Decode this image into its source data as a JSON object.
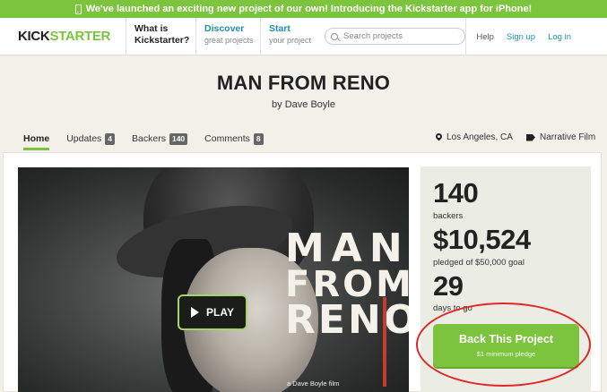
{
  "announcement": {
    "icon": "phone-icon",
    "text": "We've launched an exciting new project of our own! Introducing the Kickstarter app for iPhone!"
  },
  "header": {
    "logo": {
      "part1": "KICK",
      "part2": "STARTER"
    },
    "nav": [
      {
        "title_line1": "What is",
        "title_line2": "Kickstarter?"
      },
      {
        "title": "Discover",
        "subtitle": "great projects"
      },
      {
        "title": "Start",
        "subtitle": "your project"
      }
    ],
    "search": {
      "placeholder": "Search projects",
      "icon": "search-icon"
    },
    "links": {
      "help": "Help",
      "signup": "Sign up",
      "login": "Log in"
    }
  },
  "project": {
    "title": "MAN FROM RENO",
    "byline": "by Dave Boyle"
  },
  "tabs": [
    {
      "label": "Home",
      "active": true
    },
    {
      "label": "Updates",
      "count": "4"
    },
    {
      "label": "Backers",
      "count": "140"
    },
    {
      "label": "Comments",
      "count": "8"
    }
  ],
  "meta": {
    "location": "Los Angeles, CA",
    "location_icon": "map-pin-icon",
    "category": "Narrative Film",
    "category_icon": "tag-icon"
  },
  "video": {
    "poster_title_lines": [
      "MAN",
      "FROM",
      "RENO"
    ],
    "poster_credit": "a Dave Boyle film",
    "play_label": "PLAY"
  },
  "stats": {
    "backers_count": "140",
    "backers_label": "backers",
    "pledged_amount": "$10,524",
    "pledged_label": "pledged of $50,000 goal",
    "days_count": "29",
    "days_label": "days to go"
  },
  "cta": {
    "label": "Back This Project",
    "sublabel": "$1 minimum pledge"
  },
  "colors": {
    "accent": "#7cc33e",
    "link": "#1f8fb0",
    "annotation_circle": "#e02828"
  }
}
